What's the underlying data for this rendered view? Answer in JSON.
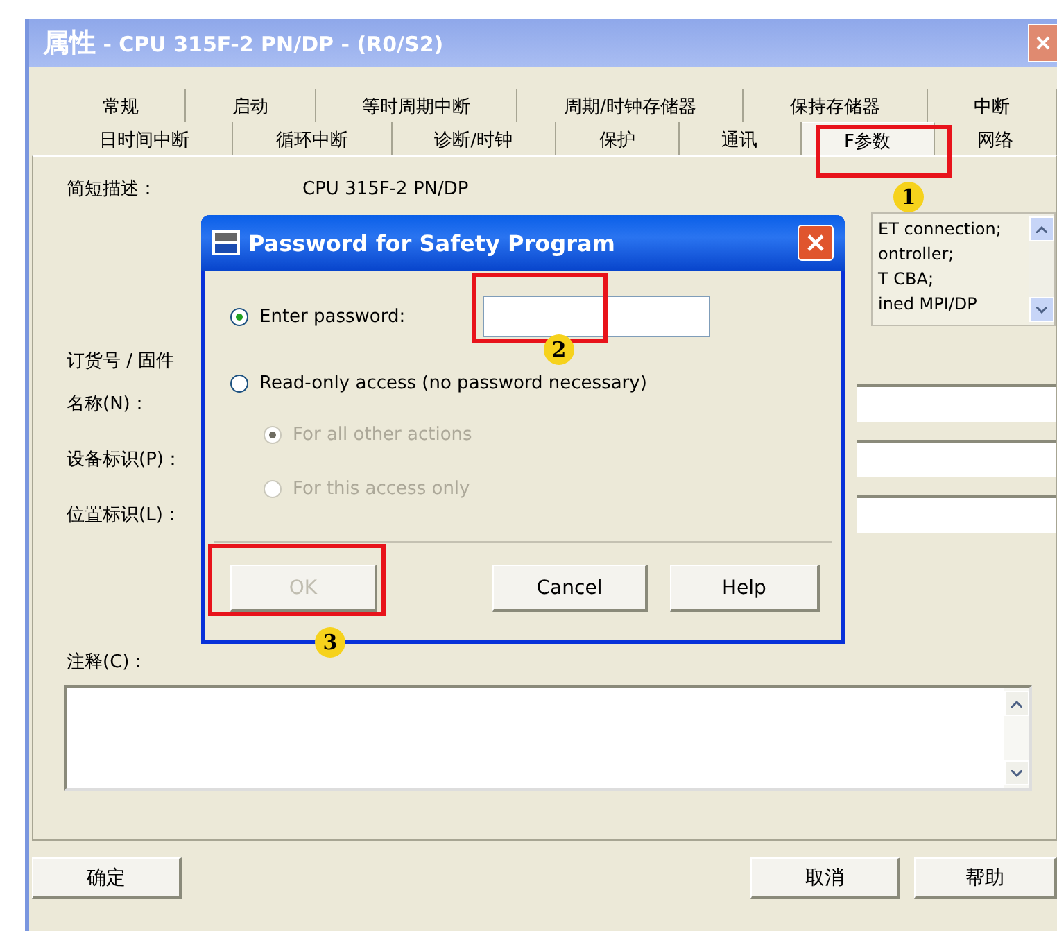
{
  "window": {
    "title_prefix": "属性",
    "title": " - CPU 315F-2 PN/DP - (R0/S2)"
  },
  "tab_rows": [
    [
      {
        "label": "常规",
        "selected": false
      },
      {
        "label": "启动",
        "selected": false
      },
      {
        "label": "等时周期中断",
        "selected": false
      },
      {
        "label": "周期/时钟存储器",
        "selected": false
      },
      {
        "label": "保持存储器",
        "selected": false
      },
      {
        "label": "中断",
        "selected": false
      }
    ],
    [
      {
        "label": "日时间中断",
        "selected": false
      },
      {
        "label": "循环中断",
        "selected": false
      },
      {
        "label": "诊断/时钟",
        "selected": false
      },
      {
        "label": "保护",
        "selected": false
      },
      {
        "label": "通讯",
        "selected": false
      },
      {
        "label": "F参数",
        "selected": true
      },
      {
        "label": "网络",
        "selected": false
      }
    ]
  ],
  "general": {
    "description_label": "简短描述：",
    "description_value": "CPU 315F-2 PN/DP",
    "description_lines": [
      "ET connection;",
      "ontroller;",
      "T CBA;",
      "ined MPI/DP"
    ],
    "order_label": "订货号 / 固件",
    "fields": [
      {
        "label": "名称(N)："
      },
      {
        "label": "设备标识(P)："
      },
      {
        "label": "位置标识(L)："
      }
    ],
    "comment_label": "注释(C)："
  },
  "buttons": [
    "确定",
    "取消",
    "帮助"
  ],
  "dialog": {
    "title": "Password for Safety Program",
    "options": [
      {
        "label": "Enter password:",
        "selected": true,
        "disabled": false,
        "kind": "password"
      },
      {
        "label": "Read-only access (no password necessary)",
        "selected": false,
        "disabled": false,
        "kind": "plain",
        "children": [
          {
            "label": "For all other actions",
            "selected": true,
            "disabled": true
          },
          {
            "label": "For this access only",
            "selected": false,
            "disabled": true
          }
        ]
      }
    ],
    "buttons": [
      {
        "label": "OK",
        "disabled": true
      },
      {
        "label": "Cancel",
        "disabled": false
      },
      {
        "label": "Help",
        "disabled": false
      }
    ]
  },
  "annotations": [
    {
      "number": "1"
    },
    {
      "number": "2"
    },
    {
      "number": "3"
    }
  ]
}
